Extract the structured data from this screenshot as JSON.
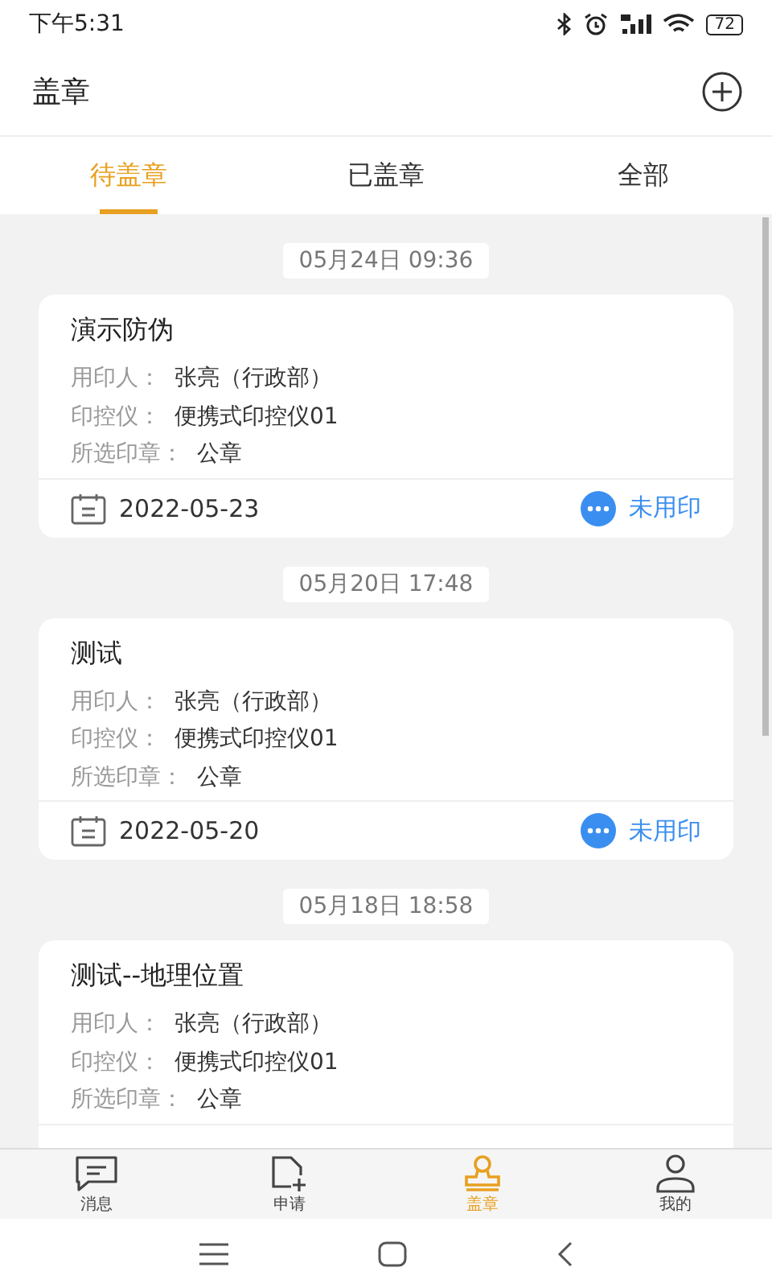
{
  "status_bar": {
    "time": "下午5:31",
    "battery": "72"
  },
  "header": {
    "title": "盖章"
  },
  "tabs": [
    {
      "label": "待盖章",
      "selected": true
    },
    {
      "label": "已盖章",
      "selected": false
    },
    {
      "label": "全部",
      "selected": false
    }
  ],
  "records": [
    {
      "time": "05月24日 09:36",
      "title": "演示防伪",
      "fields": [
        {
          "label": "用印人：",
          "value": "张亮（行政部）"
        },
        {
          "label": "印控仪：",
          "value": "便携式印控仪01"
        },
        {
          "label": "所选印章：",
          "value": "公章"
        }
      ],
      "footer": {
        "date": "2022-05-23",
        "status": "未用印"
      }
    },
    {
      "time": "05月20日 17:48",
      "title": "测试",
      "fields": [
        {
          "label": "用印人：",
          "value": "张亮（行政部）"
        },
        {
          "label": "印控仪：",
          "value": "便携式印控仪01"
        },
        {
          "label": "所选印章：",
          "value": "公章"
        }
      ],
      "footer": {
        "date": "2022-05-20",
        "status": "未用印"
      }
    },
    {
      "time": "05月18日 18:58",
      "title": "测试--地理位置",
      "fields": [
        {
          "label": "用印人：",
          "value": "张亮（行政部）"
        },
        {
          "label": "印控仪：",
          "value": "便携式印控仪01"
        },
        {
          "label": "所选印章：",
          "value": "公章"
        }
      ]
    }
  ],
  "bottom_nav": [
    {
      "kind": "message",
      "label": "消息",
      "selected": false
    },
    {
      "kind": "apply",
      "label": "申请",
      "selected": false
    },
    {
      "kind": "stamp",
      "label": "盖章",
      "selected": true
    },
    {
      "kind": "profile",
      "label": "我的",
      "selected": false
    }
  ]
}
